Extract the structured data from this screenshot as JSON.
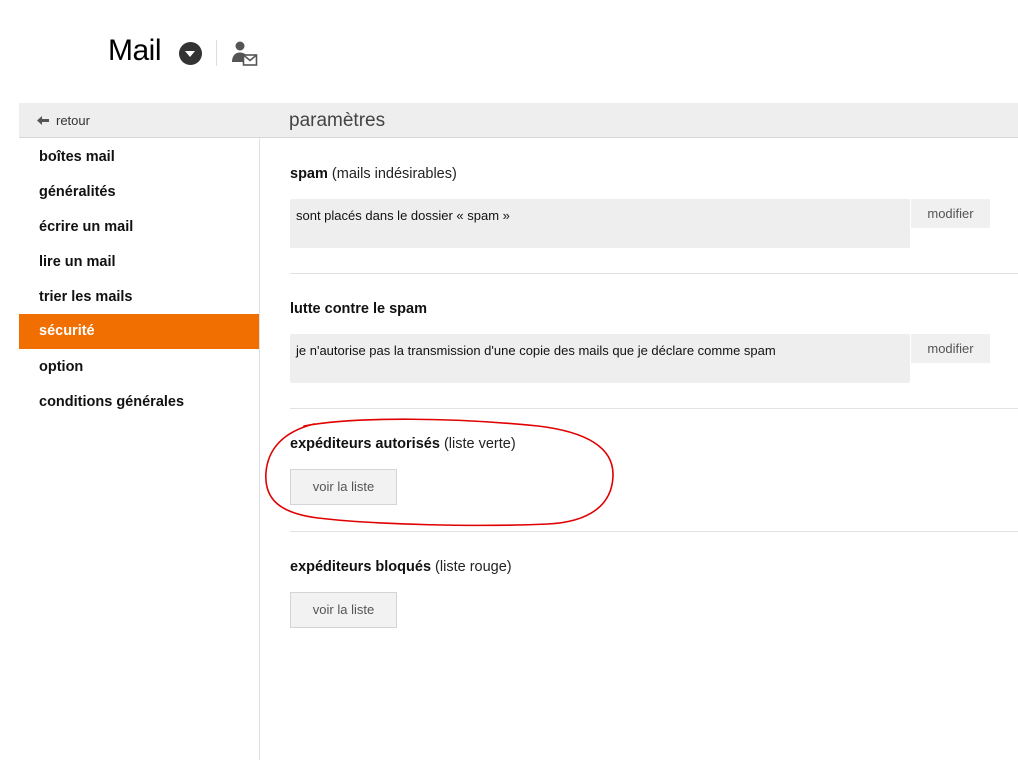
{
  "header": {
    "app_title": "Mail",
    "dropdown_icon": "chevron-down-circle-icon",
    "contact_icon": "user-mail-icon"
  },
  "topbar": {
    "back_label": "retour",
    "page_title": "paramètres"
  },
  "sidebar": {
    "accent_color": "#f16e00",
    "items": [
      {
        "label": "boîtes mail",
        "active": false
      },
      {
        "label": "généralités",
        "active": false
      },
      {
        "label": "écrire un mail",
        "active": false
      },
      {
        "label": "lire un mail",
        "active": false
      },
      {
        "label": "trier les mails",
        "active": false
      },
      {
        "label": "sécurité",
        "active": true
      },
      {
        "label": "option",
        "active": false
      },
      {
        "label": "conditions générales",
        "active": false
      }
    ]
  },
  "main": {
    "spam": {
      "title": "spam",
      "subtitle": "(mails indésirables)",
      "value": "sont placés dans le dossier « spam »",
      "button": "modifier"
    },
    "anti_spam": {
      "title": "lutte contre le spam",
      "value": "je n'autorise pas la transmission d'une copie des mails que je déclare comme spam",
      "button": "modifier"
    },
    "allowed_senders": {
      "title": "expéditeurs autorisés",
      "subtitle": "(liste verte)",
      "button": "voir la liste"
    },
    "blocked_senders": {
      "title": "expéditeurs bloqués",
      "subtitle": "(liste rouge)",
      "button": "voir la liste"
    }
  },
  "annotation_color": "#e00000"
}
